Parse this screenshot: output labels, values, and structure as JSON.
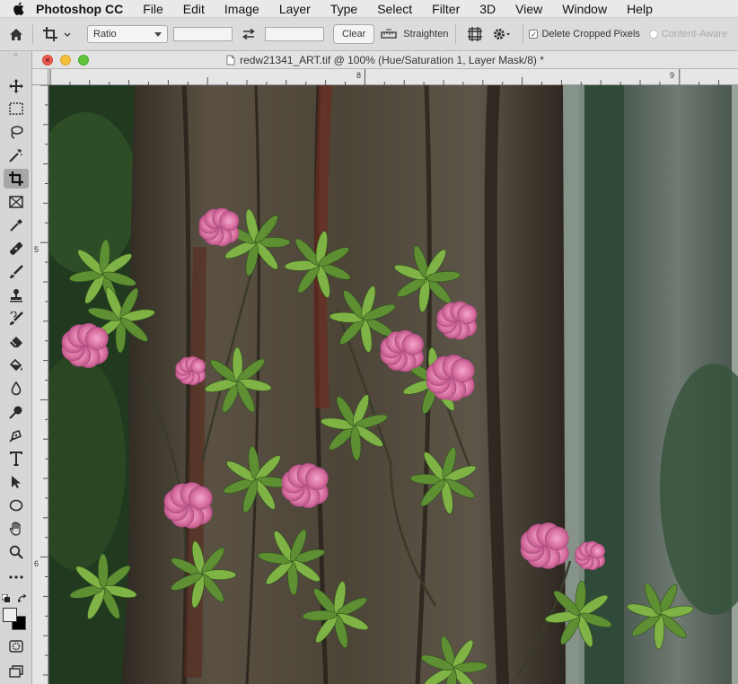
{
  "menubar": {
    "app_name": "Photoshop CC",
    "menus": [
      "File",
      "Edit",
      "Image",
      "Layer",
      "Type",
      "Select",
      "Filter",
      "3D",
      "View",
      "Window",
      "Help"
    ]
  },
  "options": {
    "ratio_value": "Ratio",
    "clear_label": "Clear",
    "straighten_label": "Straighten",
    "delete_cropped_label": "Delete Cropped Pixels",
    "delete_cropped_checked": true,
    "content_aware_label": "Content-Aware"
  },
  "document": {
    "title": "redw21341_ART.tif @ 100% (Hue/Saturation 1, Layer Mask/8) *",
    "ruler_top_labels": [
      "8",
      "9"
    ],
    "ruler_left_labels": [
      "5",
      "6"
    ]
  },
  "colors": {
    "foreground": "#ededed",
    "background": "#000000",
    "accent_flower": "#e07fb3",
    "foliage": "#6fa43a"
  },
  "tools": [
    "move-tool",
    "marquee-tool",
    "lasso-tool",
    "magic-wand-tool",
    "crop-tool",
    "frame-tool",
    "eyedropper-tool",
    "healing-brush-tool",
    "brush-tool",
    "clone-stamp-tool",
    "history-brush-tool",
    "eraser-tool",
    "paint-bucket-tool",
    "blur-tool",
    "dodge-tool",
    "pen-tool",
    "type-tool",
    "path-selection-tool",
    "ellipse-tool",
    "hand-tool",
    "zoom-tool",
    "more-tools"
  ]
}
